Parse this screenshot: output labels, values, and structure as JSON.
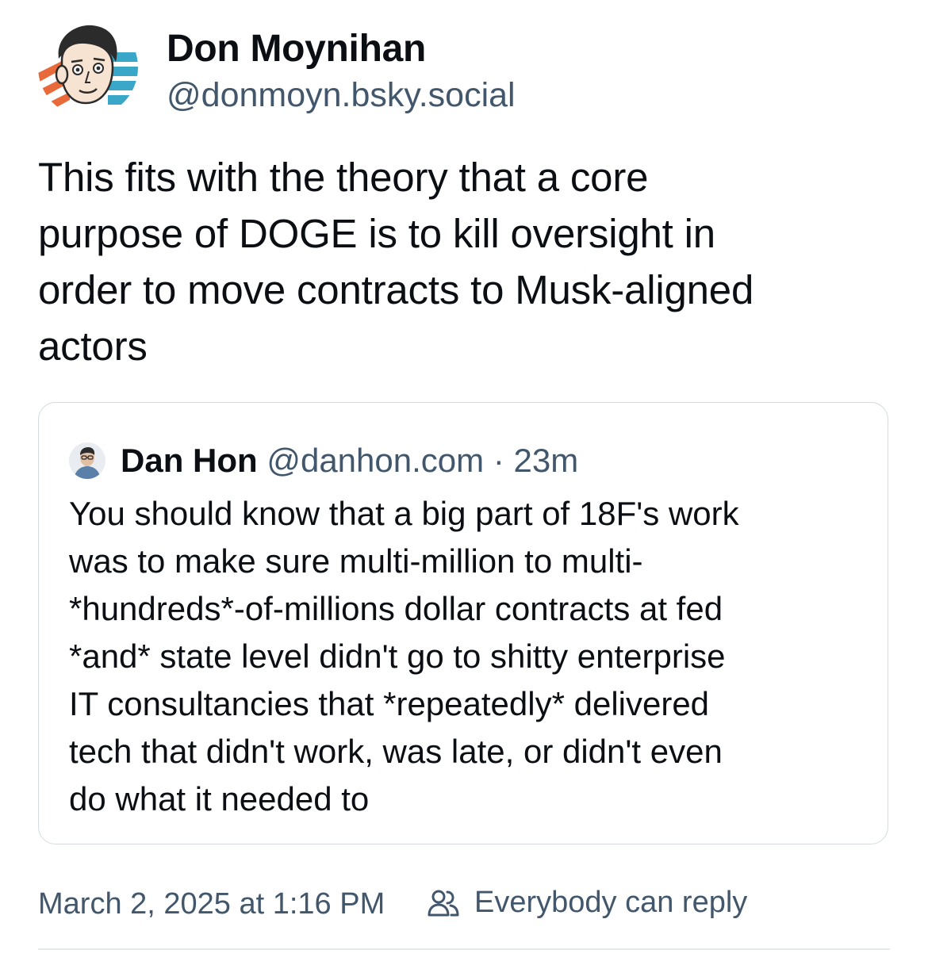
{
  "author": {
    "name": "Don Moynihan",
    "handle": "@donmoyn.bsky.social",
    "avatar_icon": "cartoon-face-avatar"
  },
  "post": {
    "text": "This fits with the theory that a core\npurpose of DOGE is to kill oversight in\norder to move contracts to Musk-aligned\nactors"
  },
  "quote": {
    "author_name": "Dan Hon",
    "author_handle": "@danhon.com",
    "separator": "·",
    "time_ago": "23m",
    "avatar_icon": "photo-avatar",
    "text": "You should know that a big part of 18F's work\nwas to make sure multi-million to multi-\n*hundreds*-of-millions dollar contracts at fed\n*and* state level didn't go to shitty enterprise\nIT consultancies that *repeatedly* delivered\ntech that didn't work, was late, or didn't even\ndo what it needed to"
  },
  "footer": {
    "timestamp": "March 2, 2025 at 1:16 PM",
    "reply_setting": "Everybody can reply",
    "reply_icon": "people-icon"
  },
  "colors": {
    "text_primary": "#0b0f14",
    "text_secondary": "#42576c",
    "border": "#d4dbe2",
    "divider": "#e3e8ed"
  }
}
